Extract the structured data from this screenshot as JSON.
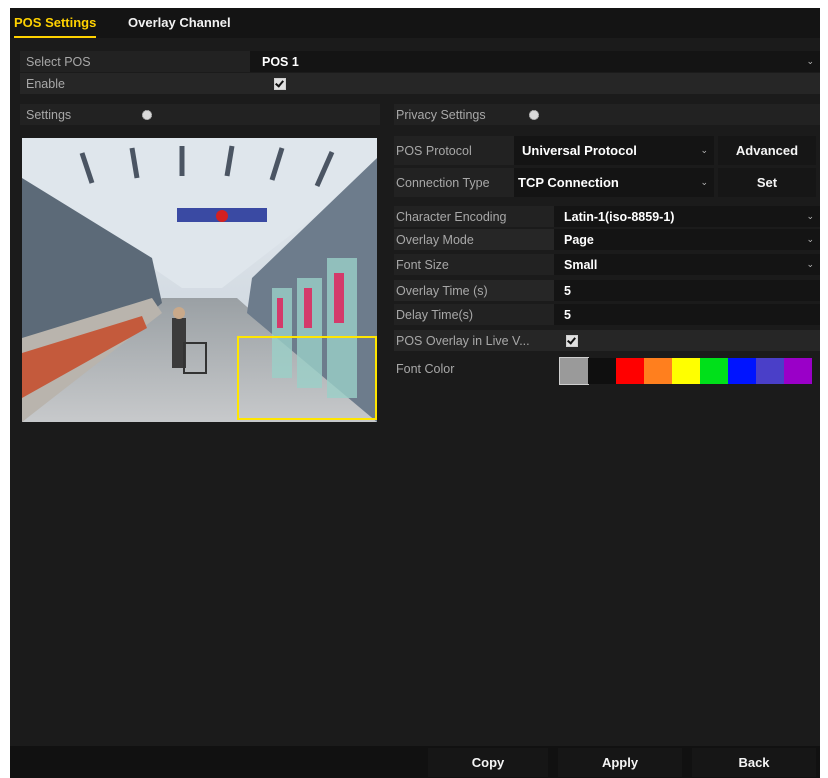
{
  "tabs": [
    {
      "label": "POS Settings",
      "active": true
    },
    {
      "label": "Overlay Channel",
      "active": false
    }
  ],
  "select_pos": {
    "label": "Select POS",
    "value": "POS 1"
  },
  "enable": {
    "label": "Enable",
    "checked": true
  },
  "settings": {
    "label": "Settings"
  },
  "privacy": {
    "label": "Privacy Settings"
  },
  "pos_protocol": {
    "label": "POS Protocol",
    "value": "Universal Protocol",
    "button": "Advanced"
  },
  "connection_type": {
    "label": "Connection Type",
    "value": "TCP Connection",
    "button": "Set"
  },
  "character_encoding": {
    "label": "Character Encoding",
    "value": "Latin-1(iso-8859-1)"
  },
  "overlay_mode": {
    "label": "Overlay Mode",
    "value": "Page"
  },
  "font_size": {
    "label": "Font Size",
    "value": "Small"
  },
  "overlay_time": {
    "label": "Overlay Time (s)",
    "value": "5"
  },
  "delay_time": {
    "label": "Delay Time(s)",
    "value": "5"
  },
  "pos_overlay_live": {
    "label": "POS Overlay in Live V...",
    "checked": true
  },
  "font_color": {
    "label": "Font Color",
    "swatches": [
      "#9a9a9a",
      "#0f0f0f",
      "#ff0000",
      "#ff7f1e",
      "#ffff00",
      "#00e01a",
      "#0014ff",
      "#4a3fc8",
      "#9a00c8"
    ],
    "selected": 0
  },
  "buttons": {
    "copy": "Copy",
    "apply": "Apply",
    "back": "Back"
  },
  "colors": {
    "accent": "#ffd200",
    "roi_box": "#ffe600"
  }
}
